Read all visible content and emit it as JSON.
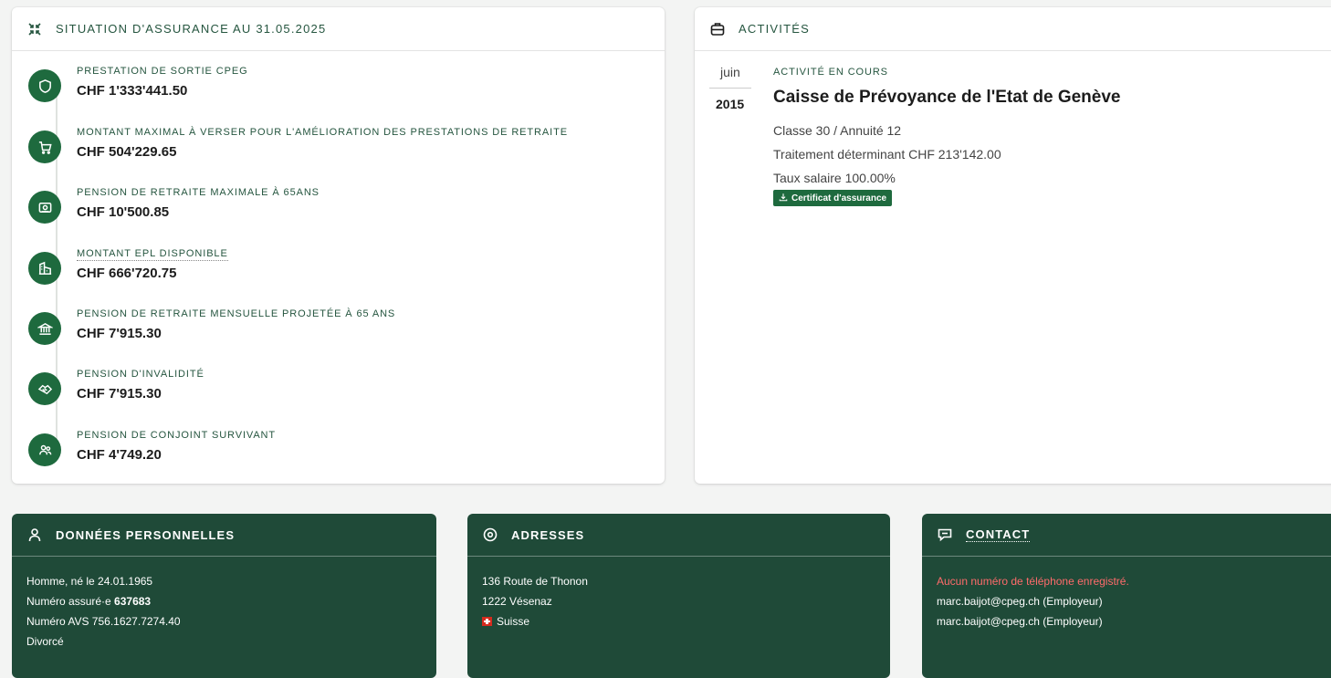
{
  "situation": {
    "title": "SITUATION D'ASSURANCE AU 31.05.2025",
    "items": [
      {
        "icon": "shield-icon",
        "label": "PRESTATION DE SORTIE CPEG",
        "value": "CHF 1'333'441.50"
      },
      {
        "icon": "cart-icon",
        "label": "MONTANT MAXIMAL À VERSER POUR L'AMÉLIORATION DES PRESTATIONS DE RETRAITE",
        "value": "CHF 504'229.65"
      },
      {
        "icon": "money-icon",
        "label": "PENSION DE RETRAITE MAXIMALE À 65ANS",
        "value": "CHF 10'500.85"
      },
      {
        "icon": "building-icon",
        "label": "MONTANT EPL DISPONIBLE",
        "value": "CHF 666'720.75"
      },
      {
        "icon": "bank-icon",
        "label": "PENSION DE RETRAITE MENSUELLE PROJETÉE À 65 ANS",
        "value": "CHF 7'915.30"
      },
      {
        "icon": "handshake-icon",
        "label": "PENSION D'INVALIDITÉ",
        "value": "CHF 7'915.30"
      },
      {
        "icon": "users-icon",
        "label": "PENSION DE CONJOINT SURVIVANT",
        "value": "CHF 4'749.20"
      }
    ]
  },
  "activites": {
    "title": "ACTIVITÉS",
    "month": "juin",
    "year": "2015",
    "status": "ACTIVITÉ EN COURS",
    "employer": "Caisse de Prévoyance de l'Etat de Genève",
    "classe": "Classe 30 / Annuité 12",
    "traitement": "Traitement déterminant CHF 213'142.00",
    "taux": "Taux salaire 100.00%",
    "cert_label": "Certificat d'assurance"
  },
  "donnees": {
    "title": "DONNÉES PERSONNELLES",
    "sexe_naissance": "Homme, né le 24.01.1965",
    "assure_prefix": "Numéro assuré·e ",
    "assure_num": "637683",
    "avs": "Numéro AVS 756.1627.7274.40",
    "etat_civil": "Divorcé"
  },
  "adresses": {
    "title": "ADRESSES",
    "rue": "136 Route de Thonon",
    "localite": "1222 Vésenaz",
    "pays": "Suisse"
  },
  "contact": {
    "title": "CONTACT",
    "phone_missing": "Aucun numéro de téléphone enregistré.",
    "email1": "marc.baijot@cpeg.ch (Employeur)",
    "email2": "marc.baijot@cpeg.ch (Employeur)"
  },
  "colors": {
    "accent": "#1e6a3e",
    "dark_card": "#1f4a38",
    "warning": "#ff6b6b"
  }
}
